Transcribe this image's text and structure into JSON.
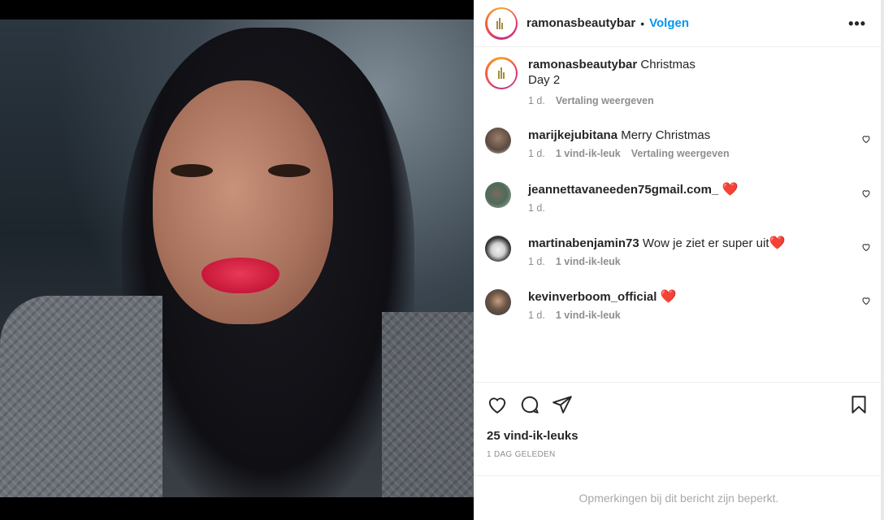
{
  "post": {
    "username": "ramonasbeautybar",
    "separator": "•",
    "follow_label": "Volgen",
    "more_label": "•••"
  },
  "caption": {
    "username": "ramonasbeautybar",
    "text_line1": "Christmas",
    "text_line2": "Day 2",
    "time": "1 d.",
    "translate": "Vertaling weergeven"
  },
  "comments": [
    {
      "username": "marijkejubitana",
      "text": "Merry Christmas",
      "time": "1 d.",
      "likes": "1 vind-ik-leuk",
      "translate": "Vertaling weergeven"
    },
    {
      "username": "jeannettavaneeden75gmail.com_",
      "text": "",
      "emoji": "❤️",
      "time": "1 d."
    },
    {
      "username": "martinabenjamin73",
      "text": "Wow je ziet er super uit",
      "emoji": "❤️",
      "time": "1 d.",
      "likes": "1 vind-ik-leuk"
    },
    {
      "username": "kevinverboom_official",
      "text": "",
      "emoji": "❤️",
      "time": "1 d.",
      "likes": "1 vind-ik-leuk"
    }
  ],
  "stats": {
    "likes": "25 vind-ik-leuks",
    "date": "1 DAG GELEDEN"
  },
  "footer": {
    "limited_text": "Opmerkingen bij dit bericht zijn beperkt."
  },
  "icons": {
    "like": "heart-icon",
    "comment": "comment-icon",
    "share": "paper-plane-icon",
    "save": "bookmark-icon"
  },
  "colors": {
    "accent": "#0095f6",
    "muted": "#8e8e8e",
    "lipstick": "#d61f40",
    "heart": "#e8112d"
  }
}
